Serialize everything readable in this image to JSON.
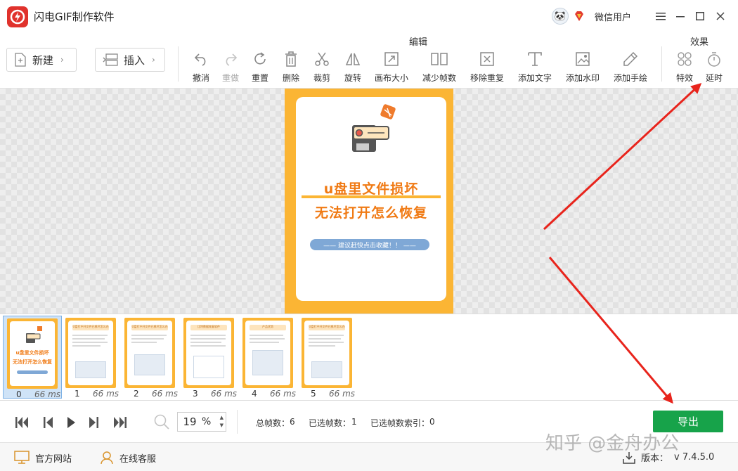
{
  "app": {
    "title": "闪电GIF制作软件",
    "user_name": "微信用户"
  },
  "toolbar": {
    "group_edit": "编辑",
    "group_effect": "效果",
    "new_label": "新建",
    "insert_label": "插入",
    "tools": {
      "undo": "撤消",
      "redo": "重做",
      "reset": "重置",
      "delete": "删除",
      "crop": "裁剪",
      "rotate": "旋转",
      "canvas_size": "画布大小",
      "reduce_frames": "减少帧数",
      "remove_duplicates": "移除重复",
      "add_text": "添加文字",
      "add_watermark": "添加水印",
      "add_drawing": "添加手绘",
      "effects": "特效",
      "delay": "延时"
    }
  },
  "preview": {
    "title_line1": "u盘里文件损坏",
    "title_line2": "无法打开怎么恢复",
    "pill_text": "——  建议赶快点击收藏！！  ——"
  },
  "frames": [
    {
      "index": "0",
      "ms": "66 ms"
    },
    {
      "index": "1",
      "ms": "66 ms"
    },
    {
      "index": "2",
      "ms": "66 ms"
    },
    {
      "index": "3",
      "ms": "66 ms"
    },
    {
      "index": "4",
      "ms": "66 ms"
    },
    {
      "index": "5",
      "ms": "66 ms"
    }
  ],
  "frame_thumbs": {
    "f0_line1": "u盘里文件损坏",
    "f0_line2": "无法打开怎么恢复",
    "f1_title": "U盘打不开文件已损坏怎么办",
    "f2_title": "U盘打不开文件已损坏怎么办",
    "f3_title": "比特数据恢复软件",
    "f4_title": "产品优势",
    "f5_title": "U盘打不开文件已损坏怎么办"
  },
  "player": {
    "zoom_value": "19",
    "zoom_unit": "%",
    "total_frames_label": "总帧数：",
    "total_frames": "6",
    "selected_frames_label": "已选帧数：",
    "selected_frames": "1",
    "selected_index_label": "已选帧数索引：",
    "selected_index": "0",
    "export_label": "导出"
  },
  "footer": {
    "website": "官方网站",
    "support": "在线客服",
    "version_label": "版本：",
    "version": "v 7.4.5.0",
    "watermark": "知乎 @金舟办公"
  },
  "colors": {
    "accent_orange": "#fbb534",
    "title_orange": "#f07a14",
    "export_green": "#17a34a",
    "arrow_red": "#e8241c"
  }
}
